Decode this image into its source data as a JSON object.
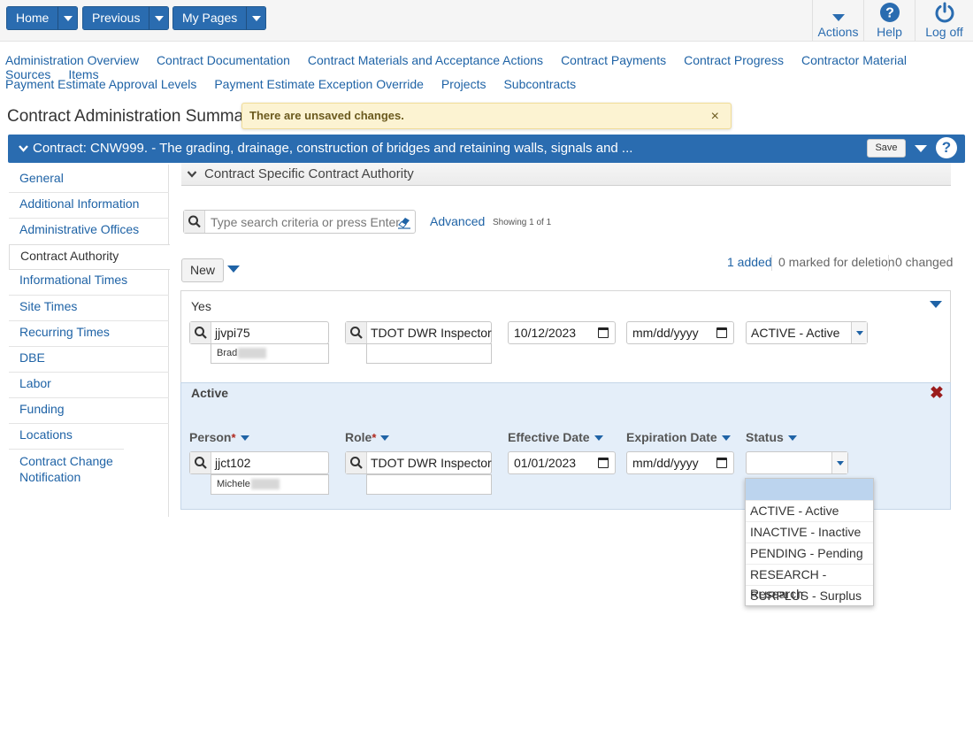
{
  "topbar": {
    "home": "Home",
    "previous": "Previous",
    "my_pages": "My Pages",
    "actions": "Actions",
    "help": "Help",
    "logoff": "Log off"
  },
  "nav": {
    "row1": [
      "Administration Overview",
      "Contract Documentation",
      "Contract Materials and Acceptance Actions",
      "Contract Payments",
      "Contract Progress",
      "Contractor Material Sources",
      "Items"
    ],
    "row2": [
      "Payment Estimate Approval Levels",
      "Payment Estimate Exception Override",
      "Projects",
      "Subcontracts"
    ]
  },
  "page_title": "Contract Administration Summa",
  "alert": {
    "message": "There are unsaved changes.",
    "close": "×"
  },
  "contract_header": {
    "text": "Contract: CNW999. - The grading, drainage, construction of bridges and retaining walls, signals and ...",
    "save": "Save",
    "help": "?"
  },
  "sidebar": {
    "items": [
      "General",
      "Additional Information",
      "Administrative Offices",
      "Contract Authority",
      "Informational Times",
      "Site Times",
      "Recurring Times",
      "DBE",
      "Labor",
      "Funding",
      "Locations",
      "Contract Change Notification"
    ],
    "active": "Contract Authority"
  },
  "section": {
    "title": "Contract Specific Contract Authority"
  },
  "search": {
    "placeholder": "Type search criteria or press Enter",
    "advanced": "Advanced",
    "showing": "Showing 1 of 1"
  },
  "toolbar": {
    "new": "New",
    "added": "1 added",
    "marked": "0 marked for deletion",
    "changed": "0 changed"
  },
  "record1": {
    "title": "Yes",
    "person_id": "jjvpi75",
    "person_name": "Brad",
    "role": "TDOT DWR Inspector",
    "effective_date": "10/12/2023",
    "expiration_date": "mm/dd/yyyy",
    "status": "ACTIVE - Active"
  },
  "record2": {
    "title": "Active",
    "labels": {
      "person": "Person",
      "role": "Role",
      "effective": "Effective Date",
      "expiration": "Expiration Date",
      "status": "Status"
    },
    "person_id": "jjct102",
    "person_name": "Michele",
    "role": "TDOT DWR Inspector",
    "effective_date": "01/01/2023",
    "expiration_date": "mm/dd/yyyy",
    "status": "",
    "status_options": [
      "",
      "ACTIVE - Active",
      "INACTIVE - Inactive",
      "PENDING - Pending",
      "RESEARCH - Research",
      "SURPLUS - Surplus"
    ]
  },
  "colors": {
    "accent": "#2a6cb0",
    "link": "#1f63a6",
    "alert_bg": "#fcf3d2",
    "selected_row_bg": "#e4eef9",
    "delete": "#9b1c1c"
  }
}
